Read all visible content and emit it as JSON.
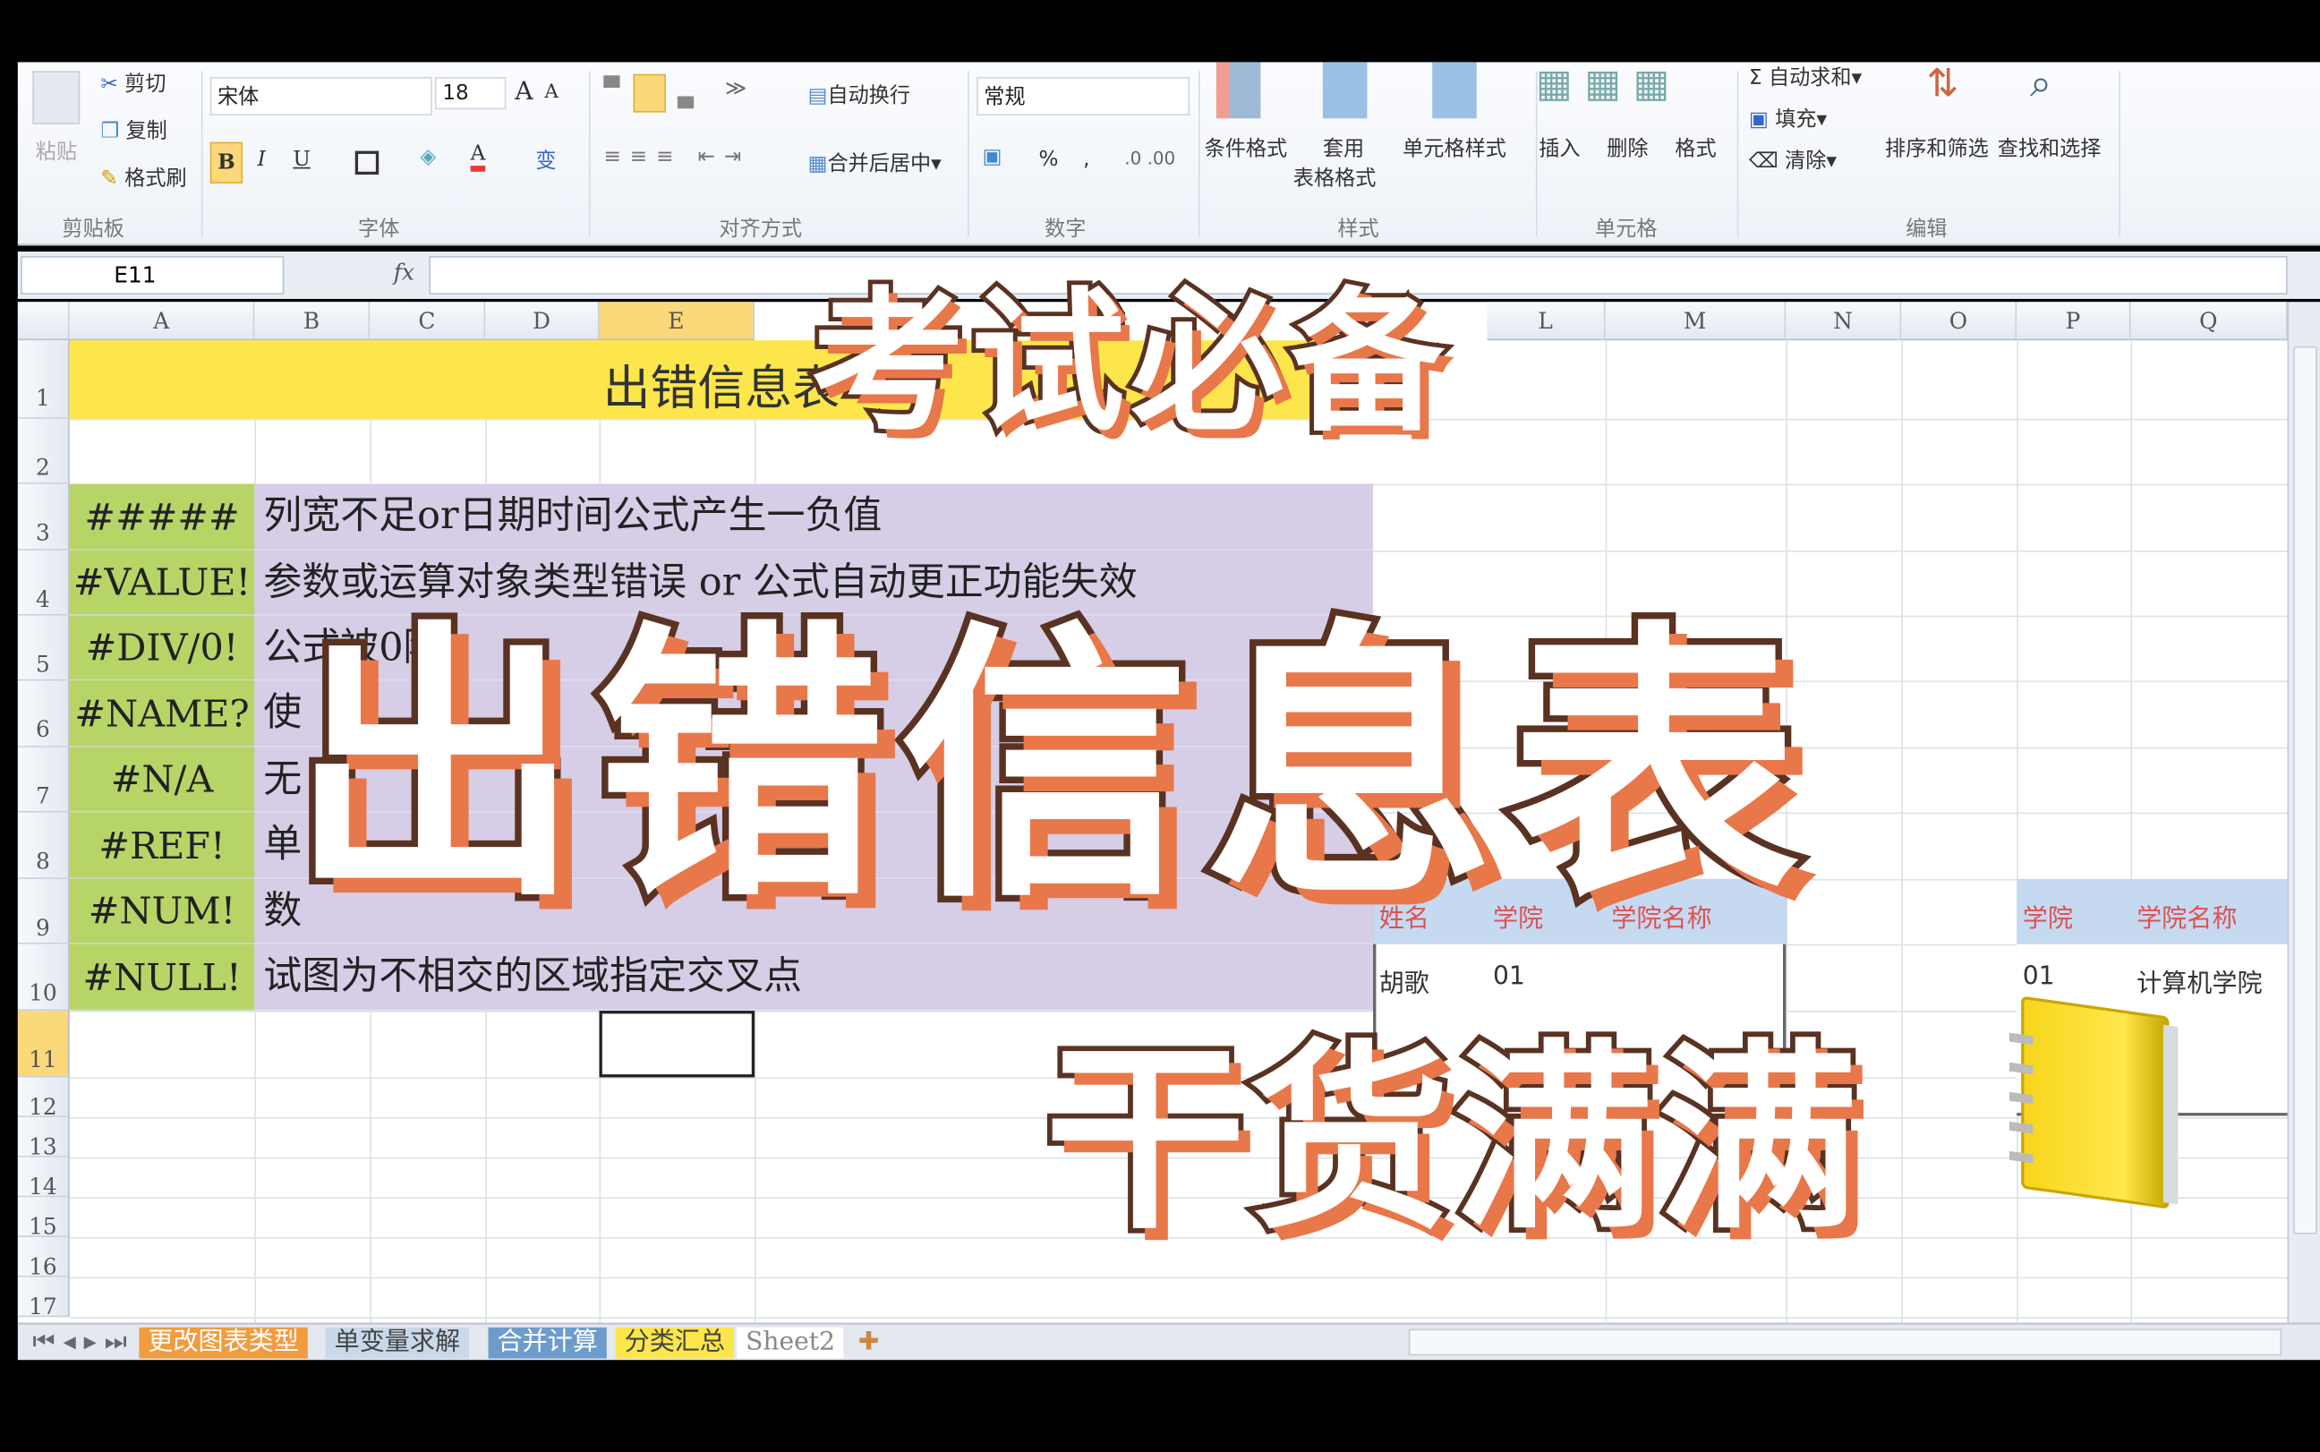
{
  "ribbon": {
    "clipboard": {
      "paste": "粘贴",
      "cut": "剪切",
      "copy": "复制",
      "format_painter": "格式刷",
      "group": "剪贴板"
    },
    "font": {
      "name": "宋体",
      "size": "18",
      "bold": "B",
      "italic": "I",
      "underline": "U",
      "grow": "A",
      "shrink": "A",
      "phonetic": "变",
      "group": "字体"
    },
    "alignment": {
      "wrap": "自动换行",
      "merge": "合并后居中",
      "group": "对齐方式"
    },
    "number": {
      "format": "常规",
      "percent": "%",
      "comma": ",",
      "group": "数字"
    },
    "styles": {
      "conditional": "条件格式",
      "table_format_1": "套用",
      "table_format_2": "表格格式",
      "cell_styles": "单元格样式",
      "group": "样式"
    },
    "cells": {
      "insert": "插入",
      "delete": "删除",
      "format": "格式",
      "group": "单元格"
    },
    "editing": {
      "autosum": "自动求和",
      "fill": "填充",
      "clear": "清除",
      "sort": "排序和筛选",
      "find": "查找和选择",
      "group": "编辑"
    }
  },
  "formula_bar": {
    "name_box": "E11",
    "fx": "fx",
    "value": ""
  },
  "columns": [
    "A",
    "B",
    "C",
    "D",
    "E",
    "L",
    "M",
    "N",
    "O",
    "P",
    "Q"
  ],
  "rows": [
    "1",
    "2",
    "3",
    "4",
    "5",
    "6",
    "7",
    "8",
    "9",
    "10",
    "11",
    "12",
    "13",
    "14",
    "15",
    "16",
    "17"
  ],
  "sheet": {
    "title": "出错信息表",
    "errors": [
      {
        "code": "#####",
        "desc": "列宽不足or日期时间公式产生一负值"
      },
      {
        "code": "#VALUE!",
        "desc": "参数或运算对象类型错误 or 公式自动更正功能失效"
      },
      {
        "code": "#DIV/0!",
        "desc": "公式被0除"
      },
      {
        "code": "#NAME?",
        "desc": "使"
      },
      {
        "code": "#N/A",
        "desc": "无"
      },
      {
        "code": "#REF!",
        "desc": "单"
      },
      {
        "code": "#NUM!",
        "desc": "数"
      },
      {
        "code": "#NULL!",
        "desc": "试图为不相交的区域指定交叉点"
      }
    ],
    "table1": {
      "headers": [
        "姓名",
        "学院",
        "学院名称"
      ],
      "row": [
        "胡歌",
        "01",
        ""
      ]
    },
    "table2": {
      "headers": [
        "学院",
        "学院名称"
      ],
      "row": [
        "01",
        "计算机学院"
      ]
    }
  },
  "sheet_tabs": [
    "更改图表类型",
    "单变量求解",
    "合并计算",
    "分类汇总",
    "Sheet2"
  ],
  "overlay": {
    "line1": "考试必备",
    "line2": "出错信息表",
    "line3": "干货满满"
  },
  "colors": {
    "code_bg": "#b7d567",
    "desc_bg": "#d6cde6",
    "title_bg": "#fde64b",
    "overlay_shadow": "#e8774a",
    "overlay_stroke": "#5a3222"
  }
}
